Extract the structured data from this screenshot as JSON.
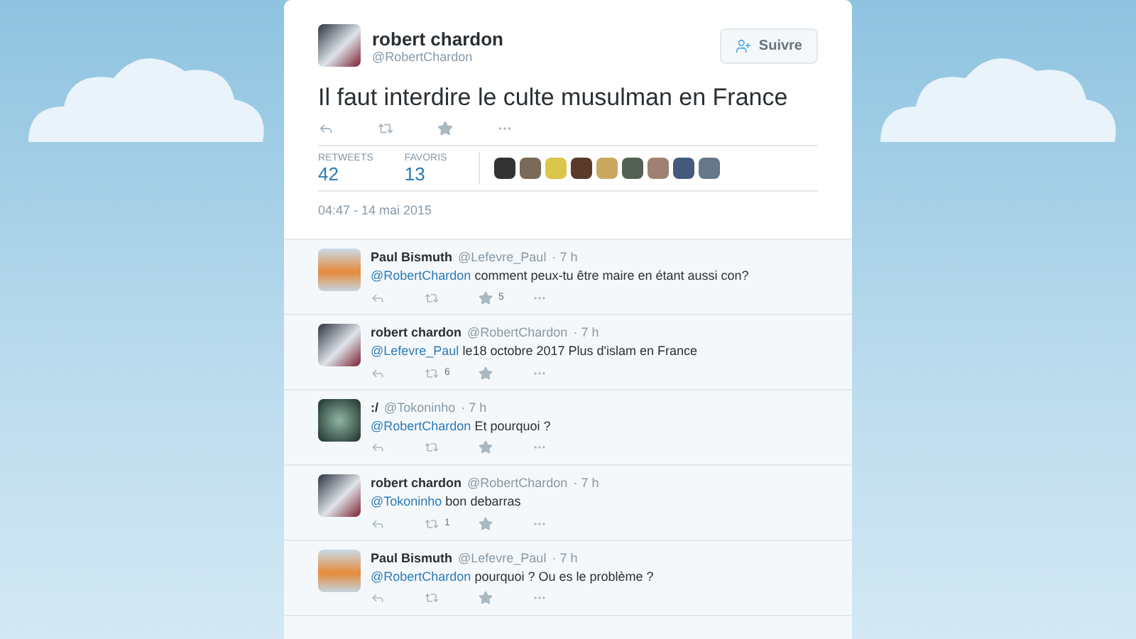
{
  "tweet": {
    "author": {
      "name": "robert chardon",
      "handle": "@RobertChardon"
    },
    "follow_button": "Suivre",
    "text": "Il faut interdire le culte musulman en France",
    "stats": [
      {
        "label": "RETWEETS",
        "value": "42"
      },
      {
        "label": "FAVORIS",
        "value": "13"
      }
    ],
    "date": "04:47 - 14 mai 2015"
  },
  "replies": [
    {
      "name": "Paul Bismuth",
      "handle": "@Lefevre_Paul",
      "time": "· 7 h",
      "kind": "drawing",
      "mention": "@RobertChardon",
      "text": " comment peux-tu être maire en étant aussi con?",
      "favorites": "5"
    },
    {
      "name": "robert chardon",
      "handle": "@RobertChardon",
      "time": "· 7 h",
      "kind": "photo",
      "mention": "@Lefevre_Paul",
      "text": " le18 octobre 2017 Plus d'islam en France",
      "retweets": "6"
    },
    {
      "name": ":/",
      "handle": "@Tokoninho",
      "time": "· 7 h",
      "kind": "mask",
      "mention": "@RobertChardon",
      "text": " Et pourquoi ?"
    },
    {
      "name": "robert chardon",
      "handle": "@RobertChardon",
      "time": "· 7 h",
      "kind": "photo",
      "mention": "@Tokoninho",
      "text": " bon debarras",
      "retweets": "1"
    },
    {
      "name": "Paul Bismuth",
      "handle": "@Lefevre_Paul",
      "time": "· 7 h",
      "kind": "drawing",
      "mention": "@RobertChardon",
      "text": " pourquoi ? Ou es le problème ?"
    }
  ]
}
